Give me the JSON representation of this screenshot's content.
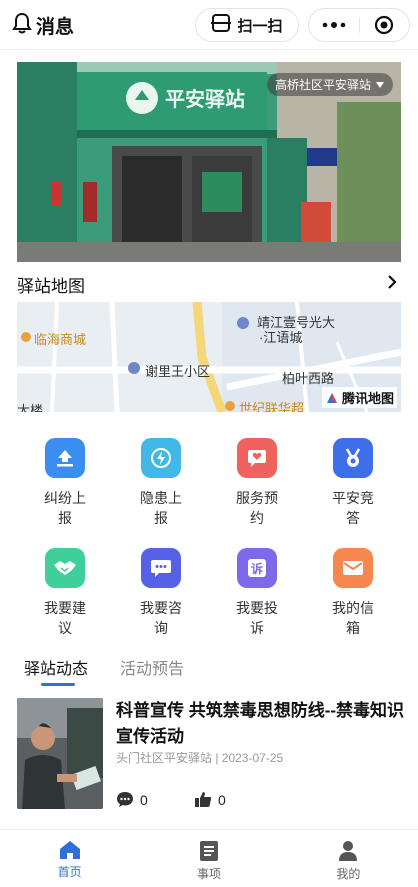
{
  "header": {
    "message_label": "消息",
    "scan_label": "扫一扫"
  },
  "banner": {
    "location_tag": "高桥社区平安驿站",
    "sign_text": "平安驿站"
  },
  "station_map": {
    "title": "驿站地图",
    "labels": [
      "临海商城",
      "靖江壹号光大",
      "·江语城",
      "谢里王小区",
      "柏叶西路",
      "世纪联华超",
      "大楼"
    ],
    "provider": "腾讯地图"
  },
  "services": [
    {
      "label": "纠纷上报",
      "icon": "upload-icon",
      "color": "#3b8ef0"
    },
    {
      "label": "隐患上报",
      "icon": "lightning-icon",
      "color": "#42b8e8"
    },
    {
      "label": "服务预约",
      "icon": "heart-chat-icon",
      "color": "#f0625e"
    },
    {
      "label": "平安竞答",
      "icon": "medal-icon",
      "color": "#3f6fe8"
    },
    {
      "label": "我要建议",
      "icon": "handshake-icon",
      "color": "#3fcf9a"
    },
    {
      "label": "我要咨询",
      "icon": "chat-icon",
      "color": "#5661e6"
    },
    {
      "label": "我要投诉",
      "icon": "complaint-icon",
      "color": "#7d6ae8"
    },
    {
      "label": "我的信箱",
      "icon": "mail-icon",
      "color": "#f5874f"
    }
  ],
  "tabs": [
    {
      "label": "驿站动态",
      "active": true
    },
    {
      "label": "活动预告",
      "active": false
    }
  ],
  "news": {
    "title": "科普宣传 共筑禁毒思想防线--禁毒知识宣传活动",
    "meta": "头门社区平安驿站 | 2023-07-25",
    "comments": "0",
    "likes": "0"
  },
  "bottom_nav": [
    {
      "label": "首页",
      "icon": "home-icon",
      "active": true
    },
    {
      "label": "事项",
      "icon": "list-icon",
      "active": false
    },
    {
      "label": "我的",
      "icon": "user-icon",
      "active": false
    }
  ],
  "colors": {
    "accent": "#2f6fd6",
    "banner_green": "#2f8f6e"
  }
}
